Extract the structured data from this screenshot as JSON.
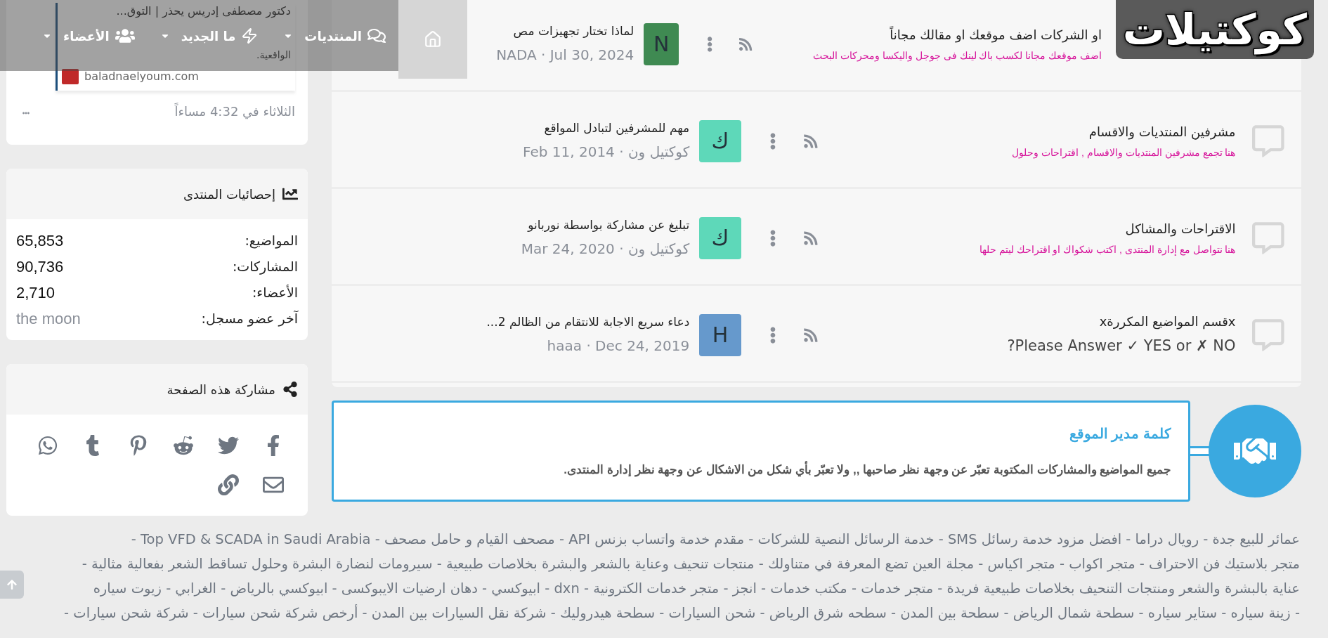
{
  "header": {
    "logo": "كوكتيلات",
    "nav": [
      {
        "kind": "home",
        "selected": true
      },
      {
        "kind": "forums",
        "label": "المنتديات",
        "selected": false
      },
      {
        "kind": "whats_new",
        "label": "ما الجديد",
        "selected": false
      },
      {
        "kind": "members",
        "label": "الأعضاء",
        "selected": false
      }
    ]
  },
  "sidebar": {
    "post_card": {
      "title": "دكتور مصطفى إدريس يحذر | التوق...",
      "snippet": "الواقعية.",
      "source": "baladnaelyoum.com",
      "time": "الثلاثاء في 4:32 مساءاً"
    },
    "stats": {
      "title": "إحصائيات المنتدى",
      "rows": [
        {
          "label": "المواضيع:",
          "value": "65,853",
          "kind": "number"
        },
        {
          "label": "المشاركات:",
          "value": "90,736",
          "kind": "number"
        },
        {
          "label": "الأعضاء:",
          "value": "2,710",
          "kind": "number"
        },
        {
          "label": "آخر عضو مسجل:",
          "value": "the moon",
          "kind": "member"
        }
      ]
    },
    "share": {
      "title": "مشاركة هذه الصفحة",
      "buttons": [
        {
          "kind": "facebook"
        },
        {
          "kind": "twitter"
        },
        {
          "kind": "reddit"
        },
        {
          "kind": "pinterest"
        },
        {
          "kind": "tumblr"
        },
        {
          "kind": "whatsapp"
        },
        {
          "kind": "email"
        },
        {
          "kind": "link"
        }
      ]
    }
  },
  "forums": [
    {
      "title": "او الشركات اضف موقعك او مقالك مجاناً",
      "description": {
        "kind": "note",
        "text": "اضف موقعك مجانا لكسب باك لينك فى جوجل واليكسا ومحركات البحث"
      },
      "latest": {
        "title": "لماذا تختار تجهيزات مص",
        "author": "NADA",
        "date": "· Jul 30, 2024",
        "avatar": "N",
        "color": "#3f8a52"
      }
    },
    {
      "title": "مشرفين المنتديات والاقسام",
      "description": {
        "kind": "note",
        "text": "هنا تجمع مشرفين المنتديات والاقسام , اقتراحات وحلول"
      },
      "latest": {
        "title": "مهم للمشرفين لتبادل المواقع",
        "author": "كوكتيل ون",
        "date": "· Feb 11, 2014",
        "avatar": "ك",
        "color": "#5ed8b9"
      }
    },
    {
      "title": "الاقتراحات والمشاكل",
      "description": {
        "kind": "note",
        "text": "هنا نتواصل مع إدارة المنتدى , اكتب شكواك او اقتراحك ليتم حلها"
      },
      "latest": {
        "title": "تبليغ عن مشاركة بواسطة نوربانو",
        "author": "كوكتيل ون",
        "date": "· Mar 24, 2020",
        "avatar": "ك",
        "color": "#5ed8b9"
      }
    },
    {
      "title": "xقسم المواضيع المكررةx",
      "description": {
        "kind": "plain",
        "text": "Please Answer ✓ YES or ✗ NO?"
      },
      "latest": {
        "title": "دعاء سريع الاجابة للانتقام من الظالم 2...",
        "author": "haaa",
        "date": "· Dec 24, 2019",
        "avatar": "H",
        "color": "#6699cc"
      }
    }
  ],
  "admin_notice": {
    "title": "كلمة مدير الموقع",
    "text": "جميع المواضيع والمشاركات المكتوبة تعبّر عن وجهة نظر صاحبها ,, ولا تعبّر بأي شكل من الاشكال عن وجهة نظر إدارة المنتدى."
  },
  "footer_links": [
    "عمائر للبيع جدة - رويال دراما - افضل مزود خدمة رسائل SMS - خدمة الرسائل النصية للشركات - مقدم خدمة واتساب بزنس API - مصحف القيام و حامل مصحف - Top VFD & SCADA in Saudi Arabia -",
    "متجر بلاستيك فن الاحتراف - متجر اكواب - متجر اكياس - مجلة العين تضع المعرفة في متناولك - منتجات تنحيف وعناية بالشعر والبشرة بخلاصات طبيعية - سيرومات لنضارة البشرة وحلول تساقط الشعر بفعالية مثالية -",
    "عناية بالبشرة والشعر ومنتجات التنحيف بخلاصات طبيعية فريدة - متجر خدمات - مكتب خدمات - انجز - متجر خدمات الكترونية - dxn - ابيوكسي - دهان ارضيات الايبوكسى - ابيوكسي بالرياض - الغرابي - زيوت سياره",
    "- زينة سياره - ستاير سياره - سطحة شمال الرياض - سطحة بين المدن - سطحه شرق الرياض - شحن السيارات - سطحة هيدروليك - شركة نقل السيارات بين المدن - أرخص شركة شحن سيارات - شركة شحن سيارات -"
  ]
}
